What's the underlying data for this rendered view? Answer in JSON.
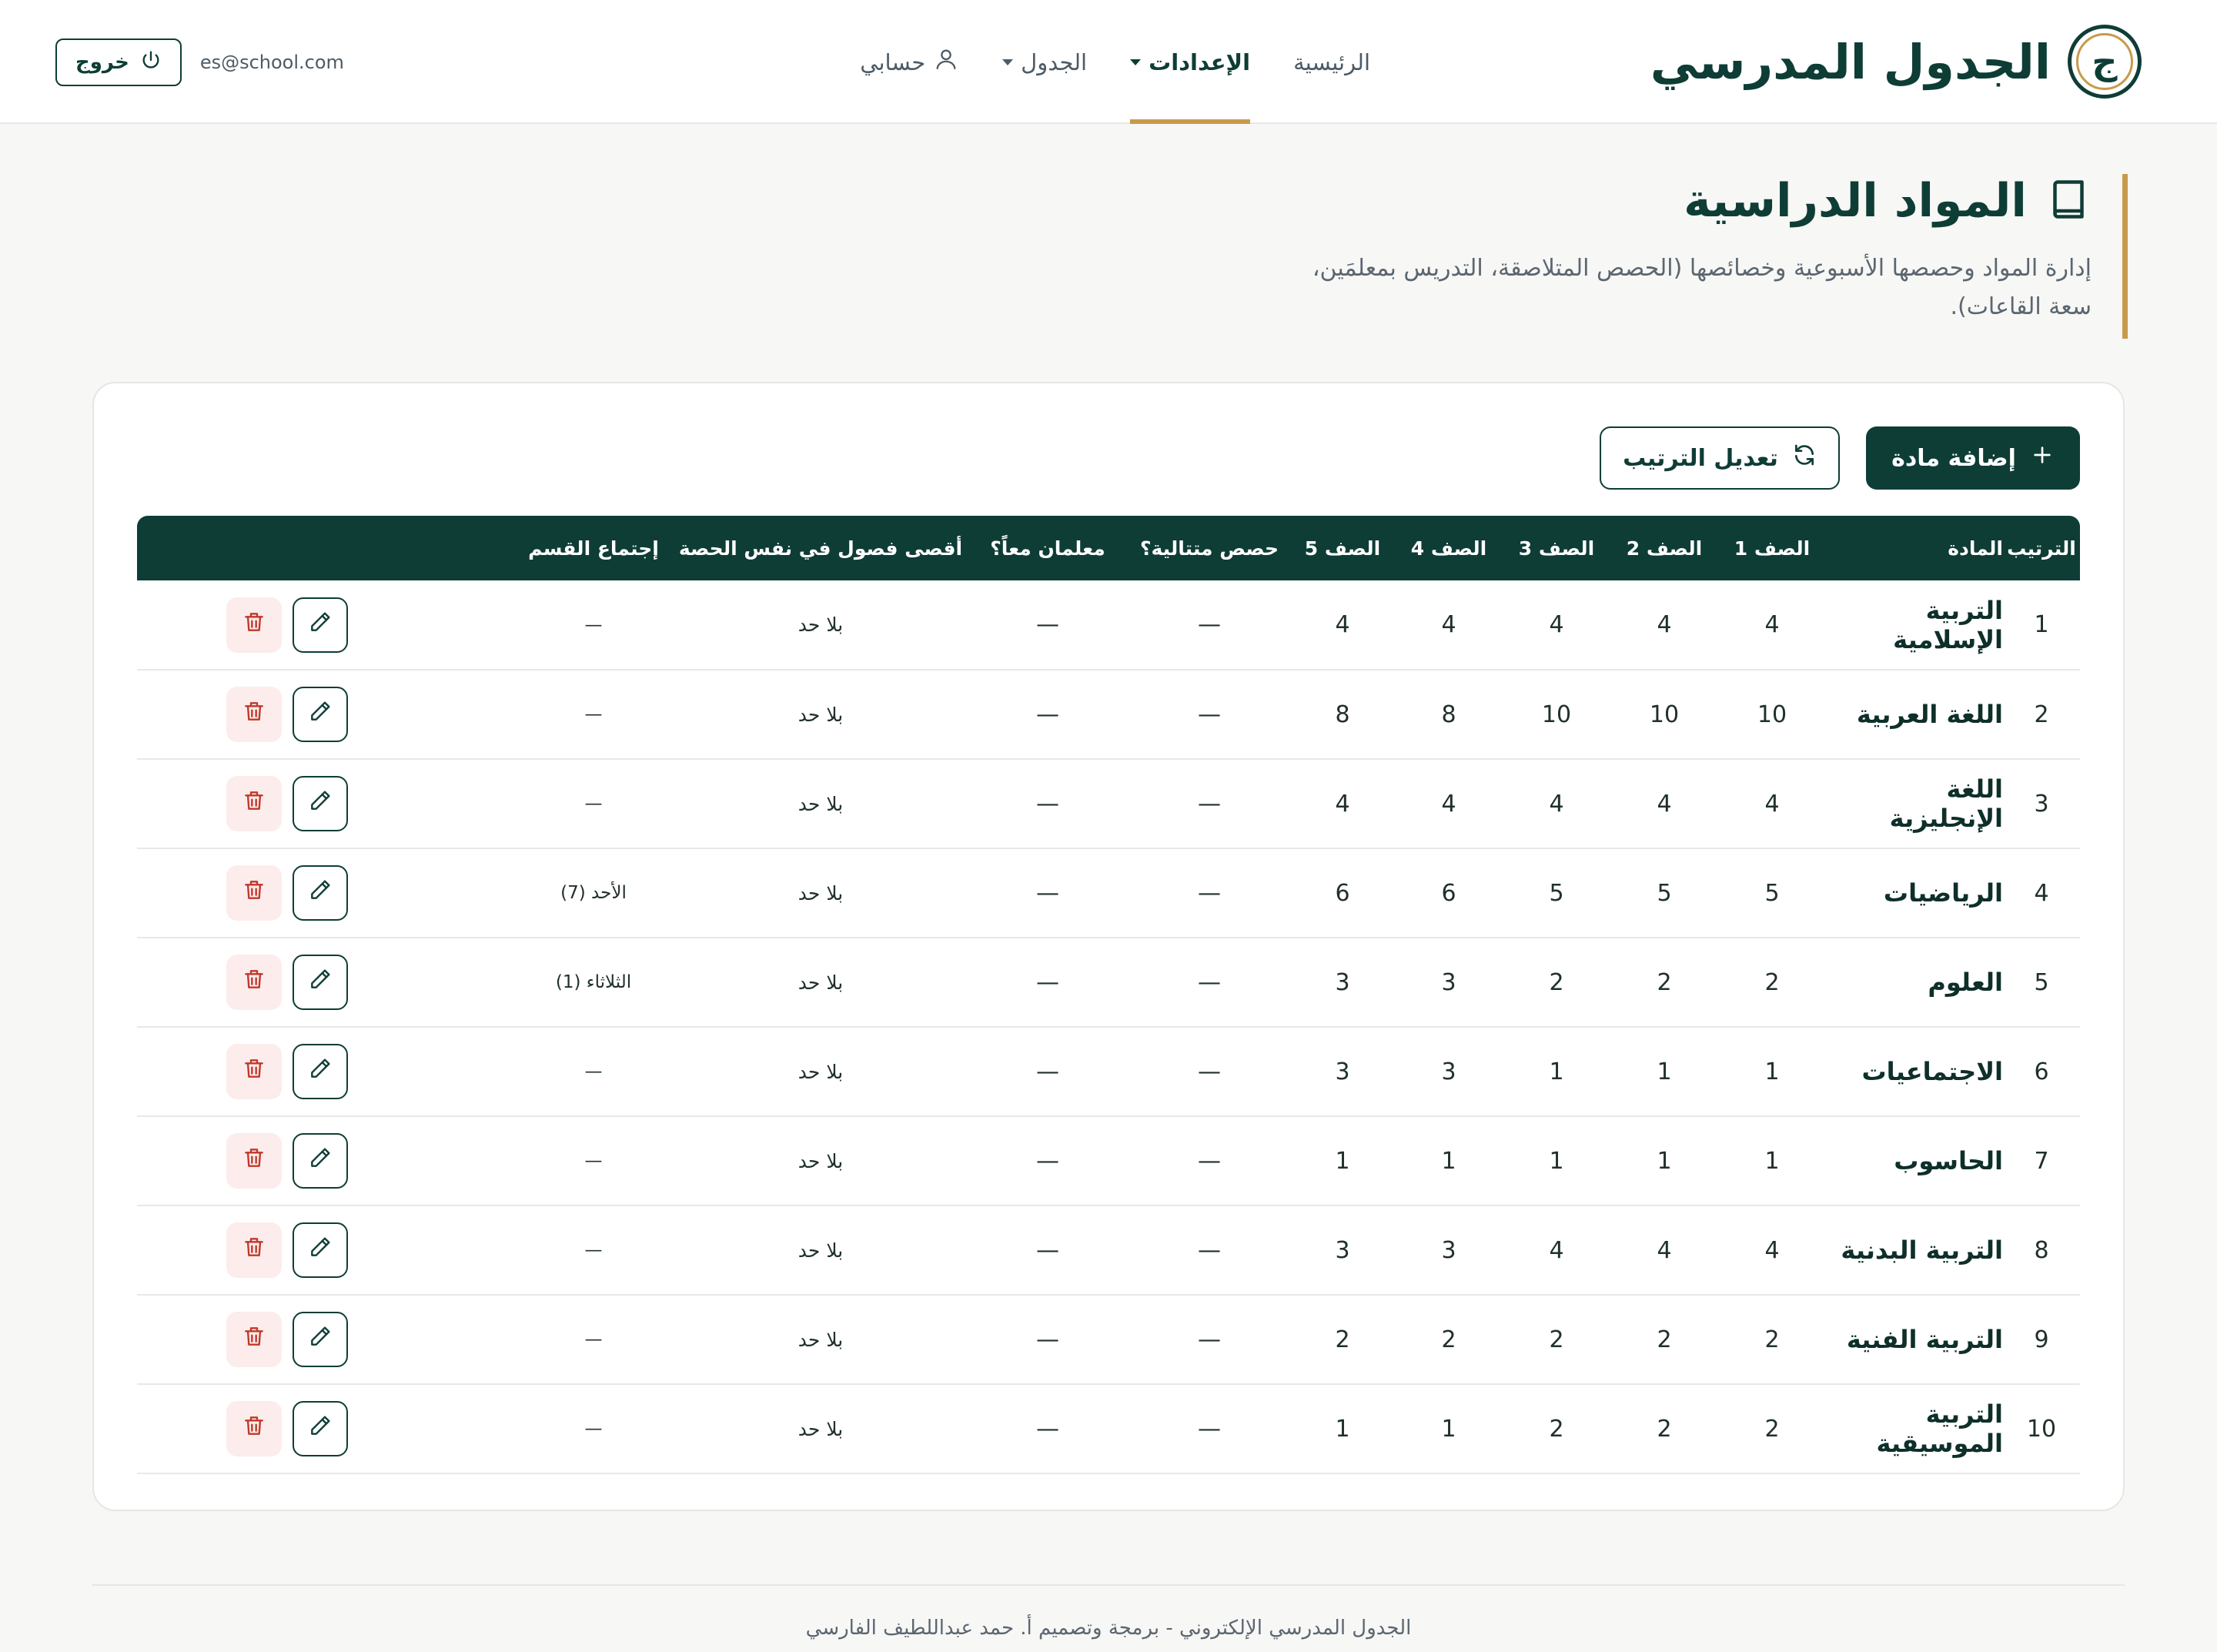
{
  "header": {
    "brand_letter": "ج",
    "brand_title": "الجدول المدرسي",
    "nav": {
      "home": "الرئيسية",
      "settings": "الإعدادات",
      "schedule": "الجدول",
      "account": "حسابي"
    },
    "user_email": "es@school.com",
    "logout_label": "خروج"
  },
  "page": {
    "title": "المواد الدراسية",
    "description_line1": "إدارة المواد وحصصها الأسبوعية وخصائصها (الحصص المتلاصقة، التدريس بمعلمَين،",
    "description_line2": "سعة القاعات)."
  },
  "actions": {
    "add_subject": "إضافة مادة",
    "reorder": "تعديل الترتيب"
  },
  "table": {
    "headers": {
      "order": "الترتيب",
      "subject": "المادة",
      "grade1": "الصف 1",
      "grade2": "الصف 2",
      "grade3": "الصف 3",
      "grade4": "الصف 4",
      "grade5": "الصف 5",
      "consecutive": "حصص متتالية؟",
      "two_teachers": "معلمان معاً؟",
      "max_classes": "أقصى فصول في نفس الحصة",
      "dept_meeting": "إجتماع القسم"
    },
    "rows": [
      {
        "order": "1",
        "name": "التربية الإسلامية",
        "g1": "4",
        "g2": "4",
        "g3": "4",
        "g4": "4",
        "g5": "4",
        "consecutive": "—",
        "two_teachers": "—",
        "max_classes": "بلا حد",
        "meeting": "—"
      },
      {
        "order": "2",
        "name": "اللغة العربية",
        "g1": "10",
        "g2": "10",
        "g3": "10",
        "g4": "8",
        "g5": "8",
        "consecutive": "—",
        "two_teachers": "—",
        "max_classes": "بلا حد",
        "meeting": "—"
      },
      {
        "order": "3",
        "name": "اللغة الإنجليزية",
        "g1": "4",
        "g2": "4",
        "g3": "4",
        "g4": "4",
        "g5": "4",
        "consecutive": "—",
        "two_teachers": "—",
        "max_classes": "بلا حد",
        "meeting": "—"
      },
      {
        "order": "4",
        "name": "الرياضيات",
        "g1": "5",
        "g2": "5",
        "g3": "5",
        "g4": "6",
        "g5": "6",
        "consecutive": "—",
        "two_teachers": "—",
        "max_classes": "بلا حد",
        "meeting": "الأحد (7)"
      },
      {
        "order": "5",
        "name": "العلوم",
        "g1": "2",
        "g2": "2",
        "g3": "2",
        "g4": "3",
        "g5": "3",
        "consecutive": "—",
        "two_teachers": "—",
        "max_classes": "بلا حد",
        "meeting": "الثلاثاء (1)"
      },
      {
        "order": "6",
        "name": "الاجتماعيات",
        "g1": "1",
        "g2": "1",
        "g3": "1",
        "g4": "3",
        "g5": "3",
        "consecutive": "—",
        "two_teachers": "—",
        "max_classes": "بلا حد",
        "meeting": "—"
      },
      {
        "order": "7",
        "name": "الحاسوب",
        "g1": "1",
        "g2": "1",
        "g3": "1",
        "g4": "1",
        "g5": "1",
        "consecutive": "—",
        "two_teachers": "—",
        "max_classes": "بلا حد",
        "meeting": "—"
      },
      {
        "order": "8",
        "name": "التربية البدنية",
        "g1": "4",
        "g2": "4",
        "g3": "4",
        "g4": "3",
        "g5": "3",
        "consecutive": "—",
        "two_teachers": "—",
        "max_classes": "بلا حد",
        "meeting": "—"
      },
      {
        "order": "9",
        "name": "التربية الفنية",
        "g1": "2",
        "g2": "2",
        "g3": "2",
        "g4": "2",
        "g5": "2",
        "consecutive": "—",
        "two_teachers": "—",
        "max_classes": "بلا حد",
        "meeting": "—"
      },
      {
        "order": "10",
        "name": "التربية الموسيقية",
        "g1": "2",
        "g2": "2",
        "g3": "2",
        "g4": "1",
        "g5": "1",
        "consecutive": "—",
        "two_teachers": "—",
        "max_classes": "بلا حد",
        "meeting": "—"
      }
    ]
  },
  "footer": {
    "text": "الجدول المدرسي الإلكتروني - برمجة وتصميم أ. حمد عبداللطيف الفارسي"
  },
  "colors": {
    "primary": "#0e3d36",
    "accent": "#c79a4b",
    "danger": "#c0392b",
    "danger_bg": "#fcecec"
  },
  "icons": {
    "brand": "brand-logo-icon",
    "user": "user-icon",
    "logout": "power-icon",
    "page": "book-icon",
    "add": "plus-icon",
    "reorder": "refresh-icon",
    "edit": "pencil-icon",
    "delete": "trash-icon"
  }
}
